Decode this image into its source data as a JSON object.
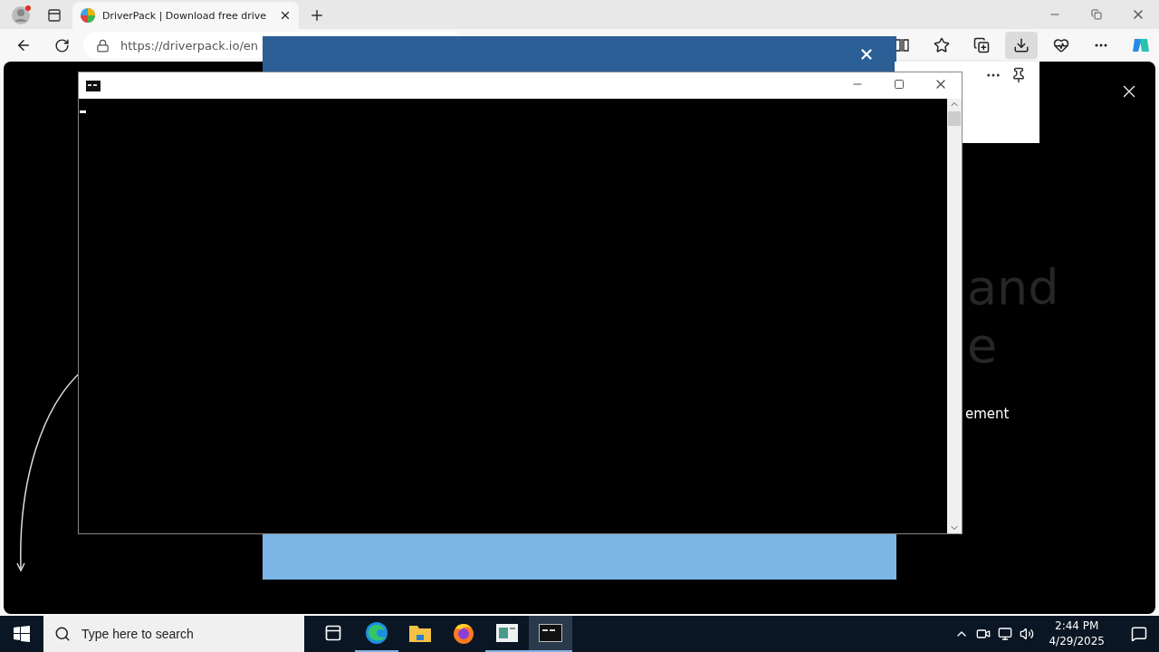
{
  "browser": {
    "tabs": [
      {
        "title": "DriverPack | Download free drive",
        "selected": true
      }
    ],
    "address": "https://driverpack.io/en"
  },
  "page": {
    "heading_fragments": [
      "and",
      "e"
    ],
    "text_fragment": "ement"
  },
  "taskbar": {
    "search": {
      "placeholder": "Type here to search"
    },
    "apps": [
      {
        "kind": "taskview",
        "running": false,
        "selected": false
      },
      {
        "kind": "edge",
        "running": true,
        "selected": false
      },
      {
        "kind": "explorer",
        "running": false,
        "selected": false
      },
      {
        "kind": "firefox",
        "running": false,
        "selected": false
      },
      {
        "kind": "notepad",
        "running": true,
        "selected": false
      },
      {
        "kind": "console",
        "running": true,
        "selected": true
      }
    ],
    "time": "2:44 PM",
    "date": "4/29/2025"
  }
}
